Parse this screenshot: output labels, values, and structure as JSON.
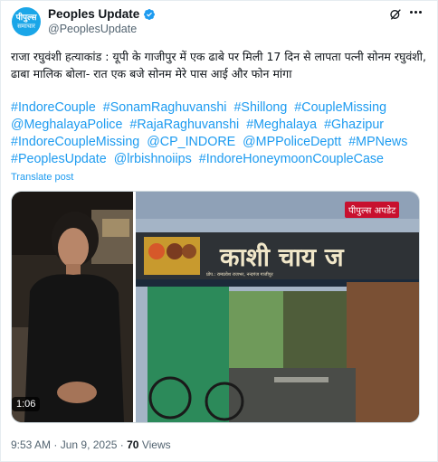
{
  "account": {
    "avatar_line1": "पीपुल्स",
    "avatar_line2": "समाचार",
    "name": "Peoples Update",
    "handle": "@PeoplesUpdate"
  },
  "post": {
    "text": "राजा रघुवंशी हत्याकांड : यूपी के गाजीपुर में एक ढाबे पर मिली 17 दिन से लापता पत्नी सोनम रघुवंशी, ढाबा मालिक बोला- रात एक बजे सोनम मेरे पास आई और फोन मांगा",
    "hashtags": [
      "#IndoreCouple",
      "#SonamRaghuvanshi",
      "#Shillong",
      "#CoupleMissing",
      "@MeghalayaPolice",
      "#RajaRaghuvanshi",
      "#Meghalaya",
      "#Ghazipur",
      "#IndoreCoupleMissing",
      "@CP_INDORE",
      "@MPPoliceDeptt",
      "#MPNews",
      "#PeoplesUpdate",
      "@lrbishnoiips",
      "#IndoreHoneymoonCoupleCase"
    ],
    "translate": "Translate post"
  },
  "media": {
    "duration": "1:06",
    "brand_tag": "पीपुल्स अपडेट",
    "sign_text": "काशी चाय ज",
    "sign_small": "प्रोप.: रामप्रवेश राजभर, नन्दगंज गाजीपुर"
  },
  "footer": {
    "time": "9:53 AM",
    "date": "Jun 9, 2025",
    "views_count": "70",
    "views_label": "Views"
  },
  "colors": {
    "link": "#1d9bf0",
    "verified": "#1d9bf0",
    "brand": "#c8102e"
  },
  "icons": [
    "verified-badge-icon",
    "grok-icon",
    "more-icon"
  ]
}
